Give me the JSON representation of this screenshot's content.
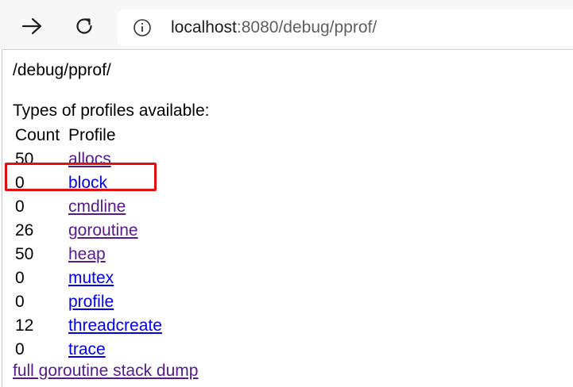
{
  "browser": {
    "url_host": "localhost",
    "url_rest": ":8080/debug/pprof/",
    "icons": {
      "back": "arrow-left-icon",
      "refresh": "refresh-icon",
      "info": "info-icon"
    }
  },
  "page": {
    "title": "/debug/pprof/",
    "types_heading": "Types of profiles available:",
    "table_headers": {
      "count": "Count",
      "profile": "Profile"
    },
    "rows": [
      {
        "count": "50",
        "profile": "allocs",
        "visited": true
      },
      {
        "count": "0",
        "profile": "block",
        "visited": false
      },
      {
        "count": "0",
        "profile": "cmdline",
        "visited": true
      },
      {
        "count": "26",
        "profile": "goroutine",
        "visited": true,
        "highlighted": true
      },
      {
        "count": "50",
        "profile": "heap",
        "visited": true
      },
      {
        "count": "0",
        "profile": "mutex",
        "visited": false
      },
      {
        "count": "0",
        "profile": "profile",
        "visited": false
      },
      {
        "count": "12",
        "profile": "threadcreate",
        "visited": false
      },
      {
        "count": "0",
        "profile": "trace",
        "visited": false
      }
    ],
    "full_dump_link": "full goroutine stack dump"
  },
  "colors": {
    "link": "#0000ee",
    "visited_link": "#551a8b",
    "highlight": "#e01010"
  }
}
